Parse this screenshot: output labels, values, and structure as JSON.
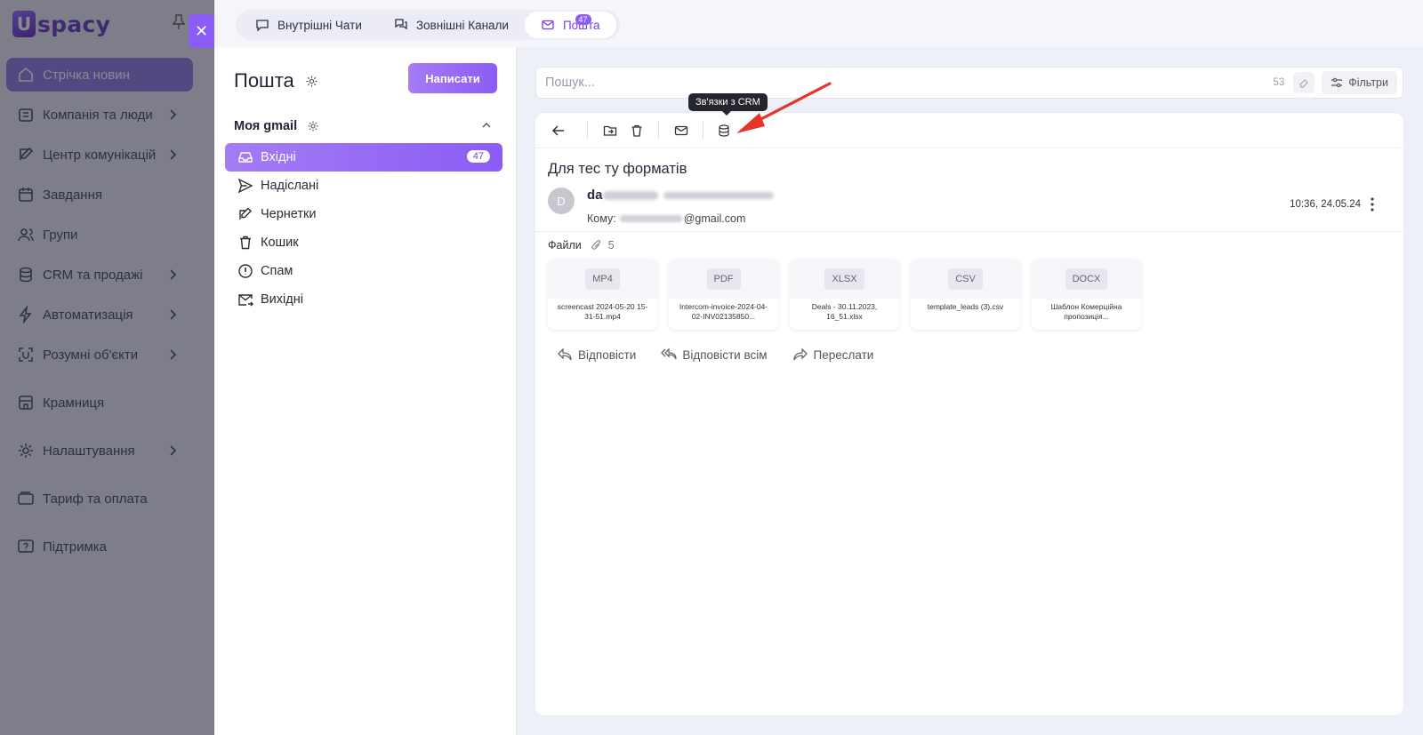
{
  "app": {
    "logo_letter": "U",
    "logo_text": "spacy",
    "brand_color": "#8b5cf6"
  },
  "sidebar": {
    "items": [
      {
        "label": "Стрічка новин"
      },
      {
        "label": "Компанія та люди"
      },
      {
        "label": "Центр комунікацій"
      },
      {
        "label": "Завдання"
      },
      {
        "label": "Групи"
      },
      {
        "label": "CRM та продажі"
      },
      {
        "label": "Автоматизація"
      },
      {
        "label": "Розумні об'єкти"
      },
      {
        "label": "Крамниця"
      },
      {
        "label": "Налаштування"
      },
      {
        "label": "Тариф та оплата"
      },
      {
        "label": "Підтримка"
      }
    ]
  },
  "tabs": [
    {
      "label": "Внутрішні Чати"
    },
    {
      "label": "Зовнішні Канали"
    },
    {
      "label": "Пошта",
      "badge": "47"
    }
  ],
  "mail": {
    "title": "Пошта",
    "compose_label": "Написати",
    "account": "Моя gmail",
    "folders": [
      {
        "label": "Вхідні",
        "count": "47"
      },
      {
        "label": "Надіслані"
      },
      {
        "label": "Чернетки"
      },
      {
        "label": "Кошик"
      },
      {
        "label": "Спам"
      },
      {
        "label": "Вихідні"
      }
    ]
  },
  "search": {
    "placeholder": "Пошук...",
    "count": "53",
    "filters_label": "Фільтри"
  },
  "toolbar": {
    "tooltip": "Зв'язки з CRM"
  },
  "message": {
    "subject": "Для тес ту форматів",
    "avatar_letter": "D",
    "sender_prefix": "da",
    "to_label": "Кому:",
    "to_suffix": "@gmail.com",
    "date": "10:36, 24.05.24",
    "files_label": "Файли",
    "files_count": "5",
    "attachments": [
      {
        "type": "MP4",
        "name": "screencast 2024-05-20 15-31-51.mp4"
      },
      {
        "type": "PDF",
        "name": "Intercom-invoice-2024-04-02-INV02135850..."
      },
      {
        "type": "XLSX",
        "name": "Deals - 30.11.2023, 16_51.xlsx"
      },
      {
        "type": "CSV",
        "name": "template_leads (3).csv"
      },
      {
        "type": "DOCX",
        "name": "Шаблон Комерційна пропозиція..."
      }
    ],
    "actions": {
      "reply": "Відповісти",
      "reply_all": "Відповісти всім",
      "forward": "Переслати"
    }
  }
}
